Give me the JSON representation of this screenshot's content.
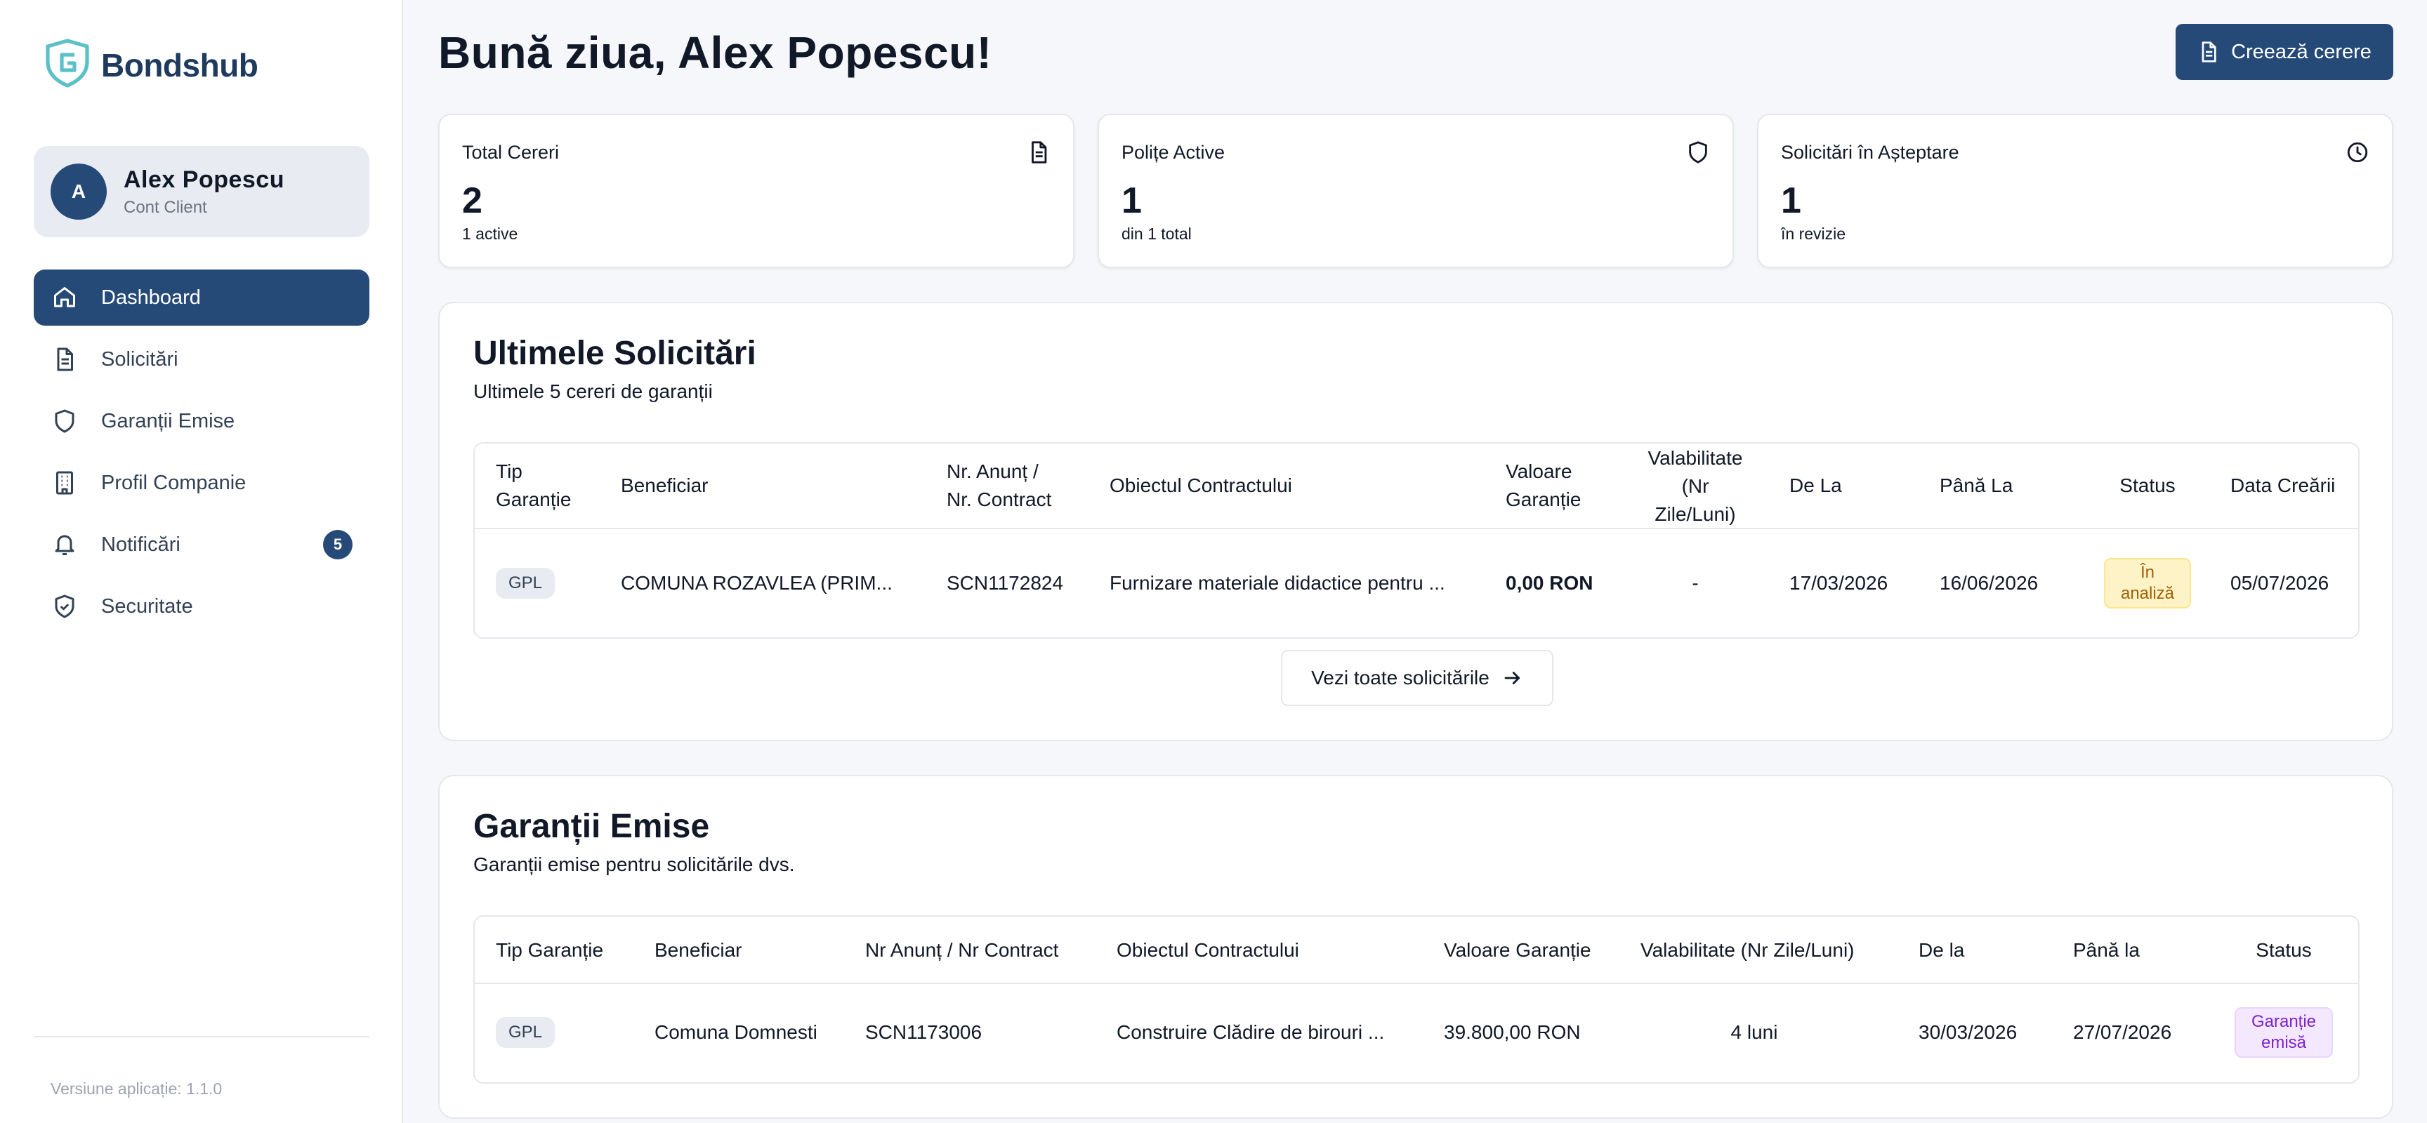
{
  "brand": {
    "name": "Bondshub",
    "accent": "#264a78",
    "logo_color": "#5bc0c7"
  },
  "user": {
    "initial": "A",
    "name": "Alex Popescu",
    "role": "Cont Client"
  },
  "nav": [
    {
      "label": "Dashboard",
      "icon": "home-icon",
      "active": true
    },
    {
      "label": "Solicitări",
      "icon": "document-icon"
    },
    {
      "label": "Garanții Emise",
      "icon": "shield-icon"
    },
    {
      "label": "Profil Companie",
      "icon": "building-icon"
    },
    {
      "label": "Notificări",
      "icon": "bell-icon",
      "badge": "5"
    },
    {
      "label": "Securitate",
      "icon": "shield-check-icon"
    }
  ],
  "version": "Versiune aplicație: 1.1.0",
  "header": {
    "title": "Bună ziua, Alex Popescu!",
    "create_label": "Creează cerere"
  },
  "stats": [
    {
      "label": "Total Cereri",
      "value": "2",
      "sub": "1 active",
      "icon": "document-icon"
    },
    {
      "label": "Polițe Active",
      "value": "1",
      "sub": "din 1 total",
      "icon": "shield-icon"
    },
    {
      "label": "Solicitări în Așteptare",
      "value": "1",
      "sub": "în revizie",
      "icon": "clock-icon"
    }
  ],
  "recent": {
    "title": "Ultimele Solicitări",
    "subtitle": "Ultimele 5 cereri de garanții",
    "columns": [
      "Tip\nGaranție",
      "Beneficiar",
      "Nr. Anunț /\nNr. Contract",
      "Obiectul Contractului",
      "Valoare\nGaranție",
      "Valabilitate\n(Nr\nZile/Luni)",
      "De La",
      "Până La",
      "Status",
      "Data Creării"
    ],
    "rows": [
      {
        "type": "GPL",
        "beneficiary": "COMUNA ROZAVLEA (PRIM...",
        "contract": "SCN1172824",
        "object": "Furnizare materiale didactice pentru ...",
        "value": "0,00 RON",
        "validity": "-",
        "from": "17/03/2026",
        "to": "16/06/2026",
        "status": "În\nanaliză",
        "created": "05/07/2026"
      }
    ],
    "view_all_label": "Vezi toate solicitările"
  },
  "issued": {
    "title": "Garanții Emise",
    "subtitle": "Garanții emise pentru solicitările dvs.",
    "columns": [
      "Tip Garanție",
      "Beneficiar",
      "Nr Anunț / Nr Contract",
      "Obiectul Contractului",
      "Valoare Garanție",
      "Valabilitate (Nr Zile/Luni)",
      "De la",
      "Până la",
      "Status"
    ],
    "rows": [
      {
        "type": "GPL",
        "beneficiary": "Comuna Domnesti",
        "contract": "SCN1173006",
        "object": "Construire Clădire de birouri ...",
        "value": "39.800,00 RON",
        "validity": "4 luni",
        "from": "30/03/2026",
        "to": "27/07/2026",
        "status": "Garanție\nemisă"
      }
    ]
  }
}
